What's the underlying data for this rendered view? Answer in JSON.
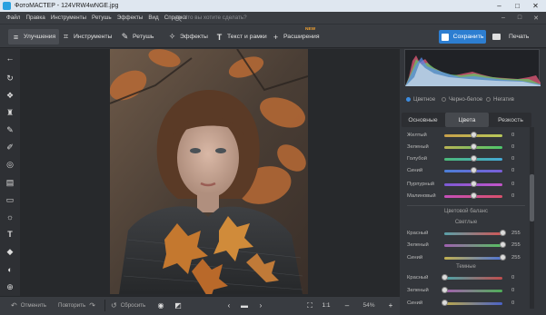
{
  "window": {
    "title": "ФотоМАСТЕР - 124VRW4wNGE.jpg",
    "min": "–",
    "max": "□",
    "close": "✕"
  },
  "menu": {
    "items": [
      "Файл",
      "Правка",
      "Инструменты",
      "Ретушь",
      "Эффекты",
      "Вид",
      "Справка"
    ],
    "search_placeholder": "Что вы хотите сделать?"
  },
  "toolbar": {
    "tabs": [
      {
        "label": "Улучшения",
        "icon": "sliders-icon"
      },
      {
        "label": "Инструменты",
        "icon": "crop-icon"
      },
      {
        "label": "Ретушь",
        "icon": "brush-icon"
      },
      {
        "label": "Эффекты",
        "icon": "magic-wand-icon"
      },
      {
        "label": "Текст и рамки",
        "icon": "text-icon"
      },
      {
        "label": "Расширения",
        "icon": "plus-icon"
      }
    ],
    "new_badge": "NEW",
    "save_label": "Сохранить",
    "print_label": "Печать"
  },
  "left_tools": [
    "back-arrow-icon",
    "rotate-icon",
    "color-drop-icon",
    "stamp-icon",
    "pencil-icon",
    "brush-icon",
    "target-icon",
    "gradient-icon",
    "frame-icon",
    "sun-icon",
    "text-icon",
    "bucket-icon",
    "color-palette-icon",
    "plus-circle-icon"
  ],
  "panel": {
    "modes": [
      {
        "label": "Цветное",
        "selected": true
      },
      {
        "label": "Черно-белое",
        "selected": false
      },
      {
        "label": "Негатив",
        "selected": false
      }
    ],
    "tabs": [
      "Основные",
      "Цвета",
      "Резкость"
    ],
    "active_tab": "Цвета",
    "colors": [
      {
        "label": "Желтый",
        "value": "0"
      },
      {
        "label": "Зеленый",
        "value": "0"
      },
      {
        "label": "Голубой",
        "value": "0"
      },
      {
        "label": "Синий",
        "value": "0"
      },
      {
        "label": "Пурпурный",
        "value": "0"
      },
      {
        "label": "Малиновый",
        "value": "0"
      }
    ],
    "balance_title": "Цветовой баланс",
    "lights_title": "Светлые",
    "lights": [
      {
        "label": "Красный",
        "value": "255"
      },
      {
        "label": "Зеленый",
        "value": "255"
      },
      {
        "label": "Синий",
        "value": "255"
      }
    ],
    "darks_title": "Темные",
    "darks": [
      {
        "label": "Красный",
        "value": "0"
      },
      {
        "label": "Зеленый",
        "value": "0"
      },
      {
        "label": "Синий",
        "value": "0"
      }
    ]
  },
  "bottom": {
    "undo_label": "Отменить",
    "redo_label": "Повторить",
    "reset_label": "Сбросить",
    "ratio_label": "1:1",
    "zoom_value": "54%"
  },
  "colors": {
    "accent": "#2d7ed1",
    "badge": "#f0a030"
  }
}
